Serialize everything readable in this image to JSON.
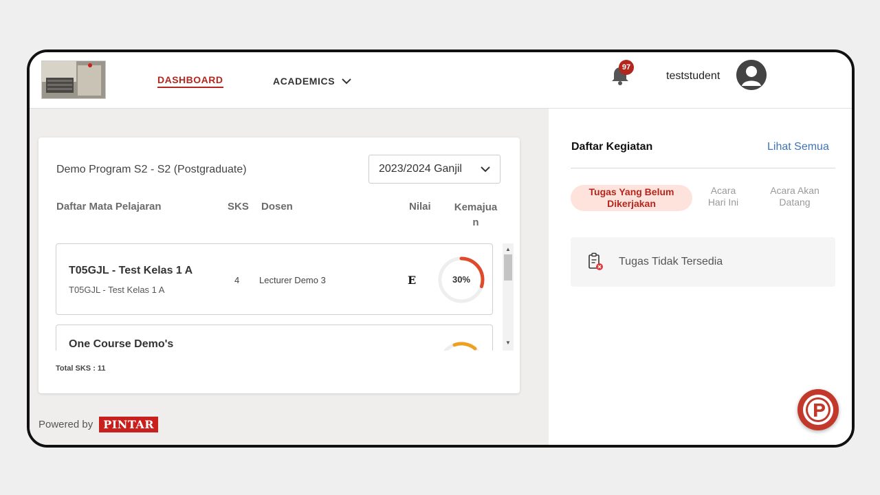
{
  "header": {
    "nav": {
      "dashboard": "DASHBOARD",
      "academics": "ACADEMICS"
    },
    "notification_count": "97",
    "username": "teststudent"
  },
  "main": {
    "program": "Demo Program S2 - S2 (Postgraduate)",
    "semester_select": "2023/2024 Ganjil",
    "columns": {
      "course": "Daftar Mata Pelajaran",
      "sks": "SKS",
      "dosen": "Dosen",
      "nilai": "Nilai",
      "progress_line1": "Kemajua",
      "progress_line2": "n"
    },
    "courses": [
      {
        "title": "T05GJL - Test Kelas 1 A",
        "subtitle": "T05GJL - Test Kelas 1 A",
        "sks": "4",
        "dosen": "Lecturer Demo 3",
        "nilai": "E",
        "progress_label": "30%",
        "progress": 0.3,
        "progress_color": "#e04a2a"
      },
      {
        "title": "One Course Demo's",
        "progress_color": "#f0a020"
      }
    ],
    "total_sks": "Total SKS : 11",
    "powered_by": "Powered by",
    "brand": "PINTAR"
  },
  "activity": {
    "title": "Daftar Kegiatan",
    "see_all": "Lihat Semua",
    "tabs": [
      {
        "line1": "Tugas Yang Belum",
        "line2": "Dikerjakan"
      },
      {
        "line1": "Acara",
        "line2": "Hari Ini"
      },
      {
        "line1": "Acara Akan",
        "line2": "Datang"
      }
    ],
    "empty_text": "Tugas Tidak Tersedia"
  },
  "colors": {
    "accent": "#b3261e",
    "link": "#3f74b5",
    "fab": "#c2382b"
  }
}
